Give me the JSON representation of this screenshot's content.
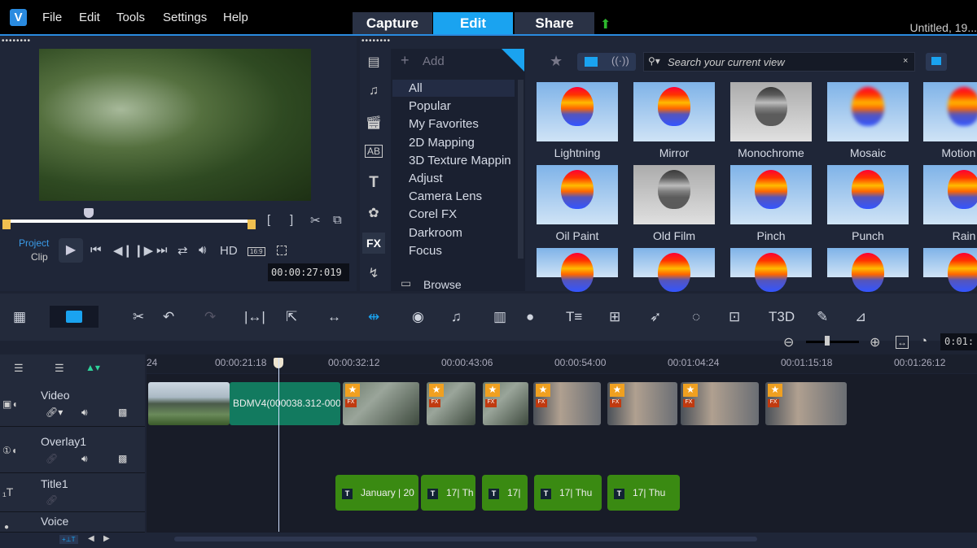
{
  "menubar": {
    "logo": "V",
    "items": [
      "File",
      "Edit",
      "Tools",
      "Settings",
      "Help"
    ],
    "tabs": [
      "Capture",
      "Edit",
      "Share"
    ],
    "active_tab": "Edit",
    "project_title": "Untitled, 19..."
  },
  "preview": {
    "mode_project": "Project",
    "mode_clip": "Clip",
    "hd": "HD",
    "aspect": "16:9",
    "timecode": "00:00:27:019"
  },
  "library": {
    "add_label": "Add",
    "categories": [
      "All",
      "Popular",
      "My Favorites",
      "2D Mapping",
      "3D Texture Mappin",
      "Adjust",
      "Camera Lens",
      "Corel FX",
      "Darkroom",
      "Focus"
    ],
    "selected_category": "All",
    "browse_label": "Browse",
    "search_placeholder": "Search your current view",
    "fx_label": "FX",
    "effects": [
      "Lightning",
      "Mirror",
      "Monochrome",
      "Mosaic",
      "Motion B",
      "Oil Paint",
      "Old Film",
      "Pinch",
      "Punch",
      "Rain",
      "",
      "",
      "",
      "",
      ""
    ]
  },
  "timeline": {
    "ruler": [
      "24",
      "00:00:21:18",
      "00:00:32:12",
      "00:00:43:06",
      "00:00:54:00",
      "00:01:04:24",
      "00:01:15:18",
      "00:01:26:12"
    ],
    "zoom_timecode": "0:01:",
    "tracks": [
      "Video",
      "Overlay1",
      "Title1",
      "Voice"
    ],
    "video_clip_label": "BDMV4(000038.312-000",
    "title_clips": [
      "January | 20",
      "17| Th",
      "17|",
      "17| Thu",
      "17| Thu"
    ]
  },
  "colors": {
    "accent": "#1aa3f0",
    "title_clip": "#3a8a12",
    "video_clip": "#127a5f"
  }
}
